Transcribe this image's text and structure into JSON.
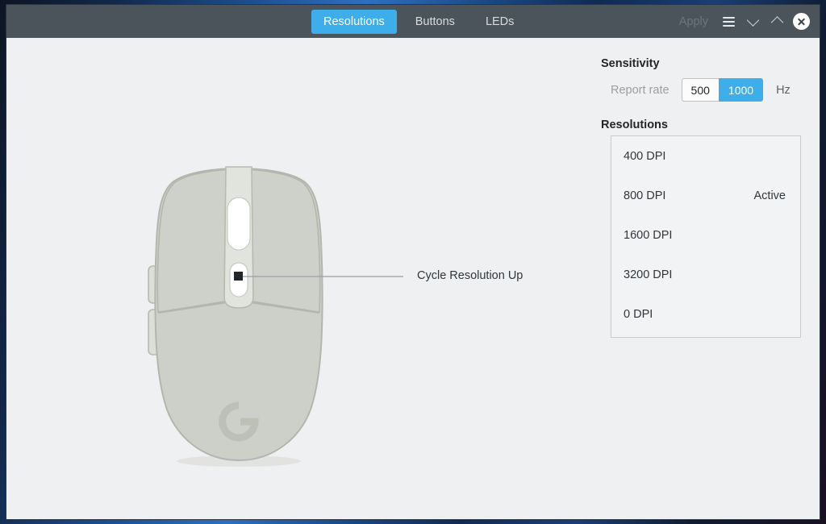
{
  "window": {
    "header": {
      "tabs": [
        {
          "label": "Resolutions",
          "active": true
        },
        {
          "label": "Buttons",
          "active": false
        },
        {
          "label": "LEDs",
          "active": false
        }
      ],
      "apply_label": "Apply",
      "menu_icon": "hamburger-menu-icon",
      "minimize_icon": "chevron-down-icon",
      "maximize_icon": "chevron-up-icon",
      "close_icon": "close-x-icon",
      "accent_color": "#3daee9",
      "bar_color": "#4b535b"
    }
  },
  "device": {
    "callout": {
      "label": "Cycle Resolution Up",
      "marker_icon": "dpi-button-marker-icon"
    },
    "brand_logo_icon": "logitech-g-logo-icon",
    "body_fill": "#cdd0c8",
    "body_stroke": "#b2b6ac"
  },
  "settings": {
    "sensitivity": {
      "heading": "Sensitivity",
      "report_rate_label": "Report rate",
      "report_rate_options": [
        {
          "label": "500",
          "selected": false
        },
        {
          "label": "1000",
          "selected": true
        }
      ],
      "unit": "Hz"
    },
    "resolutions": {
      "heading": "Resolutions",
      "items": [
        {
          "label": "400 DPI",
          "status": ""
        },
        {
          "label": "800 DPI",
          "status": "Active"
        },
        {
          "label": "1600 DPI",
          "status": ""
        },
        {
          "label": "3200 DPI",
          "status": ""
        },
        {
          "label": "0 DPI",
          "status": ""
        }
      ]
    }
  }
}
